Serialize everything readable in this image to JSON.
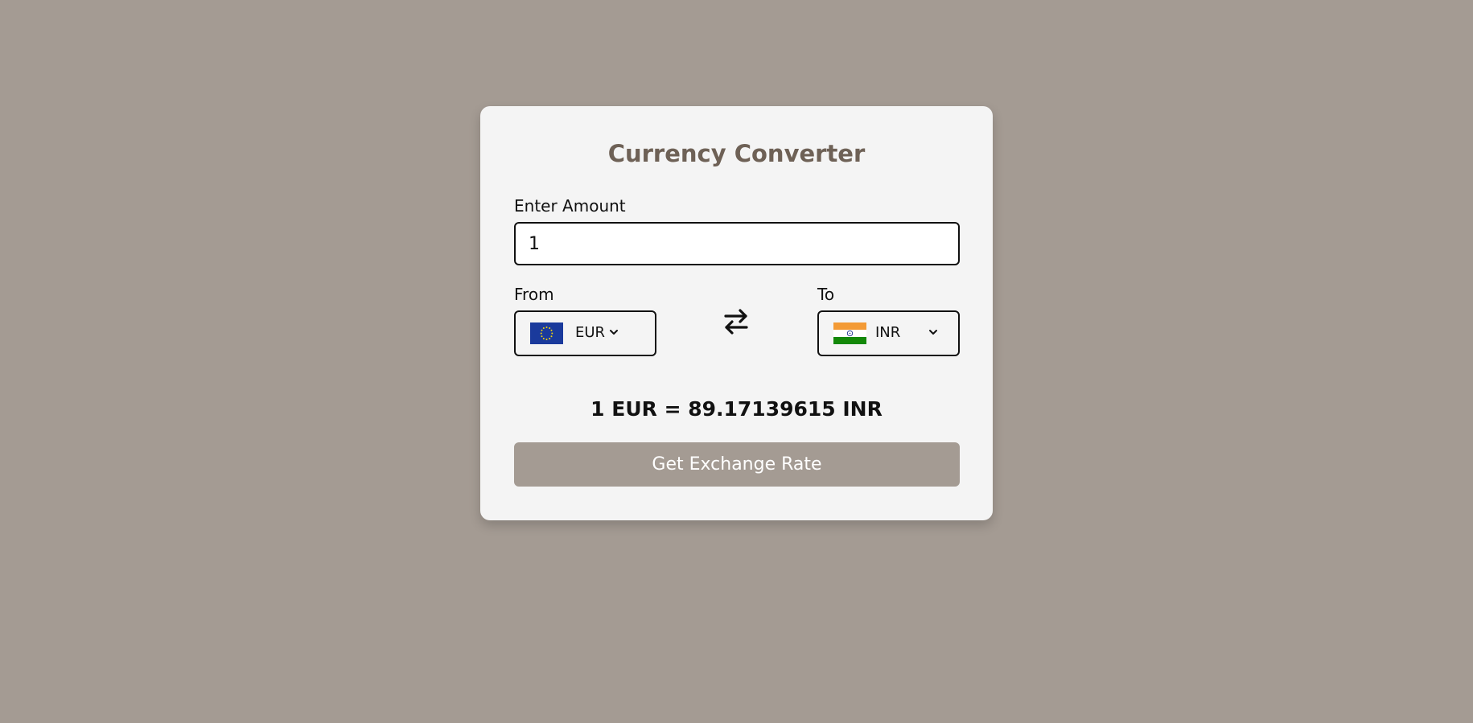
{
  "page": {
    "background_color": "#a49b93"
  },
  "card": {
    "title": "Currency Converter",
    "title_color": "#6e6156"
  },
  "amount": {
    "label": "Enter Amount",
    "value": "1"
  },
  "from": {
    "label": "From",
    "currency_code": "EUR",
    "flag_icon": "eu-flag-icon"
  },
  "to": {
    "label": "To",
    "currency_code": "INR",
    "flag_icon": "india-flag-icon"
  },
  "swap": {
    "icon": "swap-arrows-icon"
  },
  "result": {
    "text": "1 EUR = 89.17139615 INR"
  },
  "action": {
    "button_label": "Get Exchange Rate",
    "button_color": "#a49b93"
  }
}
